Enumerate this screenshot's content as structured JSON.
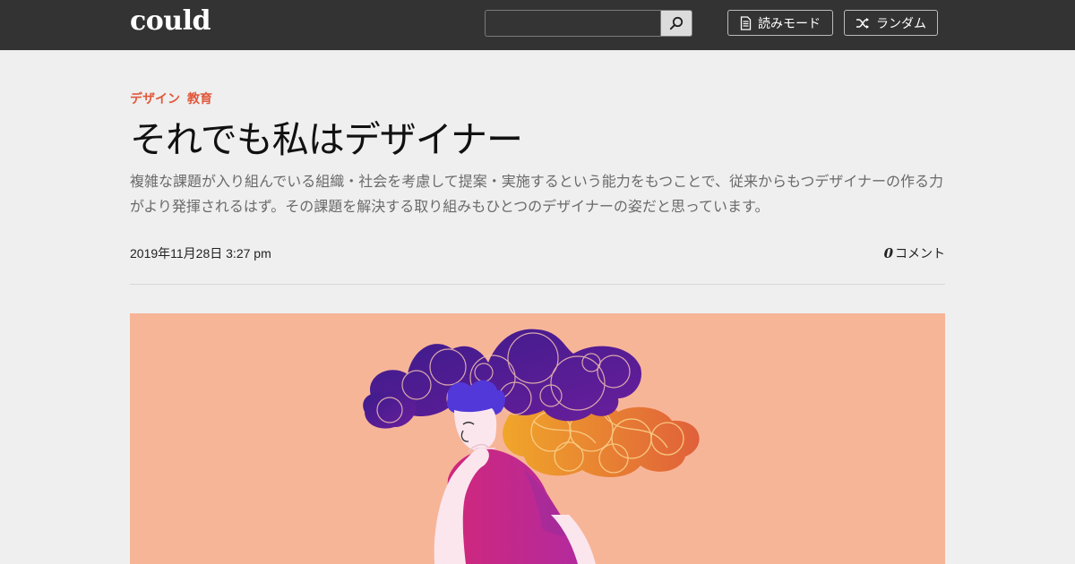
{
  "header": {
    "logo": "could",
    "search": {
      "value": "",
      "placeholder": ""
    },
    "buttons": [
      {
        "label": "読みモード",
        "icon": "document-icon"
      },
      {
        "label": "ランダム",
        "icon": "shuffle-icon"
      }
    ],
    "search_button_icon": "search-icon"
  },
  "article": {
    "categories": [
      "デザイン",
      "教育"
    ],
    "title": "それでも私はデザイナー",
    "lede": "複雑な課題が入り組んでいる組織・社会を考慮して提案・実施するという能力をもつことで、従来からもつデザイナーの作る力がより発揮されるはず。その課題を解決する取り組みもひとつのデザイナーの姿だと思っています。",
    "date": "2019年11月28日 3:27 pm",
    "comment_count": "0",
    "comment_label": "コメント"
  },
  "colors": {
    "header_bg": "#333333",
    "page_bg": "#efefef",
    "category_accent": "#e2583b",
    "hero_bg": "#f7b598"
  }
}
